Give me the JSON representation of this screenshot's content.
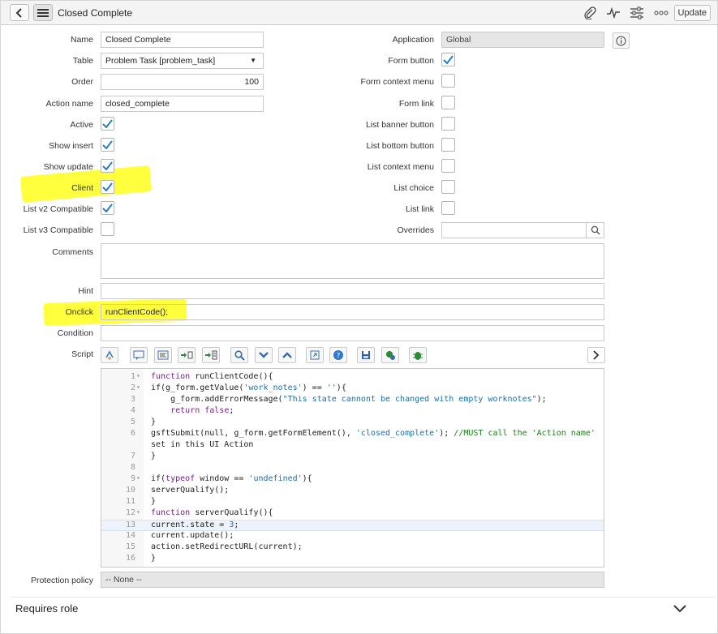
{
  "header": {
    "title": "Closed Complete",
    "update_label": "Update",
    "icons": [
      "back-icon",
      "menu-icon",
      "attachment-icon",
      "activity-icon",
      "settings-icon",
      "more-icon"
    ]
  },
  "left_labels": {
    "name": "Name",
    "table": "Table",
    "order": "Order",
    "action_name": "Action name",
    "active": "Active",
    "show_insert": "Show insert",
    "show_update": "Show update",
    "client": "Client",
    "list_v2": "List v2 Compatible",
    "list_v3": "List v3 Compatible",
    "comments": "Comments",
    "hint": "Hint",
    "onclick": "Onclick",
    "condition": "Condition",
    "script": "Script",
    "protection_policy": "Protection policy"
  },
  "right_labels": {
    "application": "Application",
    "form_button": "Form button",
    "form_context_menu": "Form context menu",
    "form_link": "Form link",
    "list_banner_button": "List banner button",
    "list_bottom_button": "List bottom button",
    "list_context_menu": "List context menu",
    "list_choice": "List choice",
    "list_link": "List link",
    "overrides": "Overrides"
  },
  "values": {
    "name": "Closed Complete",
    "table": "Problem Task [problem_task]",
    "order": "100",
    "action_name": "closed_complete",
    "application": "Global",
    "onclick": "runClientCode();",
    "protection_policy": "-- None --"
  },
  "checks": {
    "active": true,
    "show_insert": true,
    "show_update": true,
    "client": true,
    "list_v2": true,
    "list_v3": false,
    "form_button": true,
    "form_context_menu": false,
    "form_link": false,
    "list_banner_button": false,
    "list_bottom_button": false,
    "list_context_menu": false,
    "list_choice": false,
    "list_link": false
  },
  "script_lines": [
    {
      "n": "1",
      "fold": true,
      "t": "function runClientCode(){"
    },
    {
      "n": "2",
      "fold": true,
      "t": "if(g_form.getValue('work_notes') == ''){"
    },
    {
      "n": "3",
      "fold": false,
      "t": "    g_form.addErrorMessage(\"This state cannont be changed with empty worknotes\");"
    },
    {
      "n": "4",
      "fold": false,
      "t": "    return false;"
    },
    {
      "n": "5",
      "fold": false,
      "t": "}"
    },
    {
      "n": "6",
      "fold": false,
      "t": "gsftSubmit(null, g_form.getFormElement(), 'closed_complete'); //MUST call the 'Action name'"
    },
    {
      "n": "",
      "fold": false,
      "t": "set in this UI Action"
    },
    {
      "n": "7",
      "fold": false,
      "t": "}"
    },
    {
      "n": "8",
      "fold": false,
      "t": ""
    },
    {
      "n": "9",
      "fold": true,
      "t": "if(typeof window == 'undefined'){"
    },
    {
      "n": "10",
      "fold": false,
      "t": "serverQualify();"
    },
    {
      "n": "11",
      "fold": false,
      "t": "}"
    },
    {
      "n": "12",
      "fold": true,
      "t": "function serverQualify(){"
    },
    {
      "n": "13",
      "fold": false,
      "t": "current.state = 3;"
    },
    {
      "n": "14",
      "fold": false,
      "t": "current.update();"
    },
    {
      "n": "15",
      "fold": false,
      "t": "action.setRedirectURL(current);"
    },
    {
      "n": "16",
      "fold": false,
      "t": "}"
    }
  ],
  "related": {
    "requires_role": "Requires role"
  },
  "colors": {
    "highlight": "#ffff33",
    "check": "#1f7ed8"
  }
}
